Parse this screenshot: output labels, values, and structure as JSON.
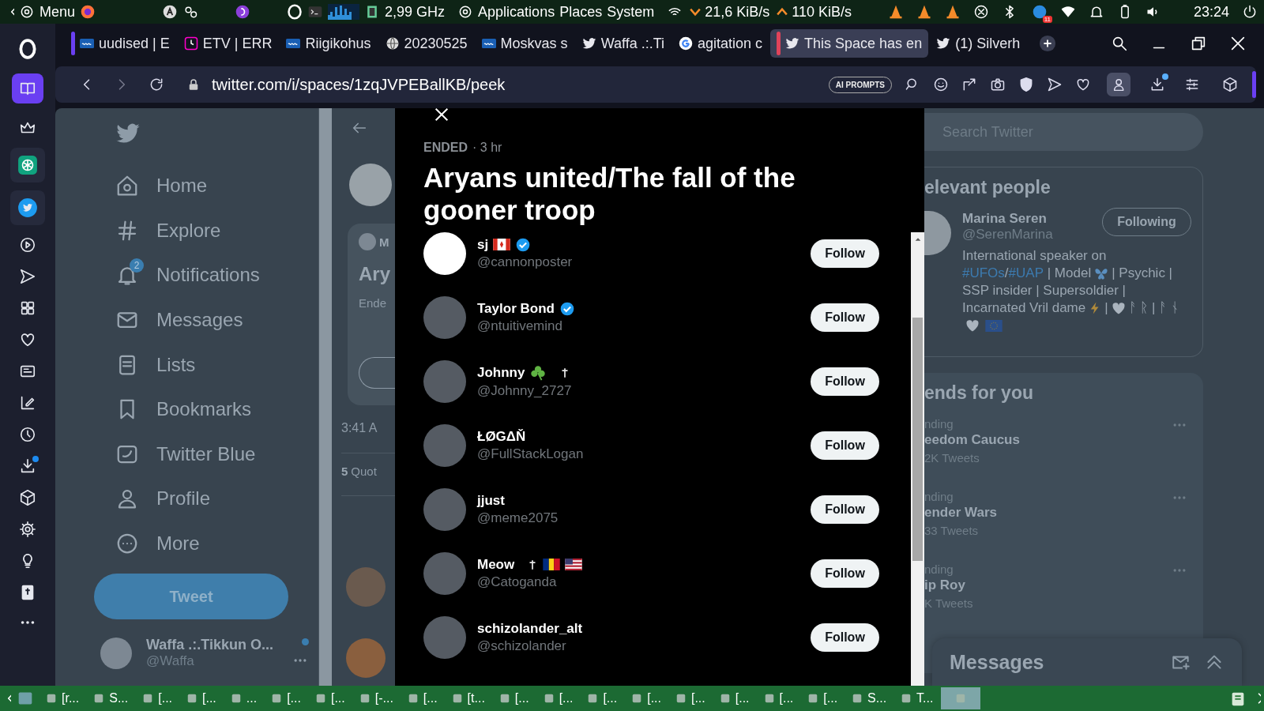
{
  "system_panel": {
    "menu": "Menu",
    "cpu": "2,99 GHz",
    "menus": [
      "Applications",
      "Places",
      "System"
    ],
    "down_speed": "21,6 KiB/s",
    "up_speed": "110 KiB/s",
    "tray_badge": "11",
    "clock": "23:24"
  },
  "opera_sidebar": [
    {
      "kind": "workspace",
      "selected": true
    },
    {
      "kind": "crown",
      "selected": false
    },
    {
      "kind": "chatgpt",
      "selected": false
    },
    {
      "kind": "twitter",
      "selected": false
    },
    {
      "kind": "player",
      "selected": false
    },
    {
      "kind": "send",
      "selected": false
    },
    {
      "kind": "grid",
      "selected": false
    },
    {
      "kind": "heart",
      "selected": false
    },
    {
      "kind": "news",
      "selected": false
    },
    {
      "kind": "pen",
      "selected": false
    },
    {
      "kind": "clock",
      "selected": false
    },
    {
      "kind": "download",
      "selected": false
    },
    {
      "kind": "cube",
      "selected": false
    },
    {
      "kind": "gear",
      "selected": false
    },
    {
      "kind": "bulb",
      "selected": false
    },
    {
      "kind": "book",
      "selected": false
    }
  ],
  "browser": {
    "tabs": [
      {
        "label": "uudised | E",
        "kind": "err",
        "selected": false,
        "color": "#6a3ff2"
      },
      {
        "label": "ETV | ERR",
        "kind": "etv",
        "selected": false
      },
      {
        "label": "Riigikohus",
        "kind": "err",
        "selected": false
      },
      {
        "label": "20230525",
        "kind": "globe",
        "selected": false
      },
      {
        "label": "Moskvas s",
        "kind": "err",
        "selected": false
      },
      {
        "label": "Waffa .:.Ti",
        "kind": "twitter",
        "selected": false
      },
      {
        "label": "agitation c",
        "kind": "google",
        "selected": false
      },
      {
        "label": "This Space has en",
        "kind": "twitter",
        "selected": true,
        "color": "#e0435a"
      },
      {
        "label": "(1) Silverh",
        "kind": "twitter",
        "selected": false
      }
    ],
    "address": "twitter.com/i/spaces/1zqJVPEBallKB/peek",
    "ai_button": "AI PROMPTS"
  },
  "twitter_nav": {
    "items": [
      {
        "label": "Home",
        "kind": "home"
      },
      {
        "label": "Explore",
        "kind": "hash"
      },
      {
        "label": "Notifications",
        "kind": "bell",
        "badge": "2"
      },
      {
        "label": "Messages",
        "kind": "mail"
      },
      {
        "label": "Lists",
        "kind": "list"
      },
      {
        "label": "Bookmarks",
        "kind": "bookmark"
      },
      {
        "label": "Twitter Blue",
        "kind": "blue"
      },
      {
        "label": "Profile",
        "kind": "person"
      },
      {
        "label": "More",
        "kind": "more"
      }
    ],
    "tweet_button": "Tweet",
    "account": {
      "name": "Waffa .:.Tikkun O...",
      "handle": "@Waffa"
    }
  },
  "background_column": {
    "card_author": "M",
    "card_title": "Ary",
    "card_status": "Ende",
    "time": "3:41 A",
    "quote_count": "5",
    "quote_label": "Quot"
  },
  "space_modal": {
    "status": "ENDED",
    "age": "· 3 hr",
    "title": "Aryans united/The fall of the gooner troop",
    "participants": [
      {
        "name": "sj",
        "handle": "@cannonposter",
        "badges": [
          {
            "kind": "flag_ca"
          },
          {
            "kind": "verified"
          }
        ],
        "button": "Follow"
      },
      {
        "name": "Taylor Bond",
        "handle": "@ntuitivemind",
        "badges": [
          {
            "kind": "verified"
          }
        ],
        "button": "Follow"
      },
      {
        "name": "Johnny",
        "handle": "@Johnny_2727",
        "badges": [
          {
            "kind": "shamrock"
          },
          {
            "kind": "cross"
          }
        ],
        "button": "Follow"
      },
      {
        "name": "ŁØGΔŇ",
        "handle": "@FullStackLogan",
        "button": "Follow"
      },
      {
        "name": "jjust",
        "handle": "@meme2075",
        "button": "Follow"
      },
      {
        "name": "Meow",
        "handle": "@Catoganda",
        "badges": [
          {
            "kind": "cross"
          },
          {
            "kind": "flag_ro"
          },
          {
            "kind": "flag_us"
          }
        ],
        "button": "Follow"
      },
      {
        "name": "schizolander_alt",
        "handle": "@schizolander",
        "button": "Follow"
      }
    ]
  },
  "right_column": {
    "search": {
      "placeholder": "Search Twitter"
    },
    "relevant": {
      "heading": "elevant people",
      "name": "Marina Seren",
      "handle": "@SerenMarina",
      "button": "Following",
      "bio": [
        [
          {
            "kind": "text",
            "text": "International speaker on"
          }
        ],
        [
          {
            "kind": "link",
            "text": "#UFOs"
          },
          {
            "kind": "text",
            "text": "/"
          },
          {
            "kind": "link",
            "text": "#UAP"
          },
          {
            "kind": "text",
            "text": " | Model"
          },
          {
            "kind": "butterfly"
          },
          {
            "kind": "text",
            "text": "| Psychic |"
          }
        ],
        [
          {
            "kind": "text",
            "text": "SSP insider | Supersoldier |"
          }
        ],
        [
          {
            "kind": "text",
            "text": "Incarnated Vril dame"
          },
          {
            "kind": "bolt"
          },
          {
            "kind": "text",
            "text": "|"
          },
          {
            "kind": "heart"
          },
          {
            "kind": "text",
            "text": "ᚨ ᚱ | ᚨ ᚾ"
          }
        ],
        [
          {
            "kind": "heart"
          },
          {
            "kind": "flag_eu"
          }
        ]
      ]
    },
    "trends": {
      "heading": "ends for you",
      "items": [
        {
          "context": "nding",
          "title": "eedom Caucus",
          "count": "2K Tweets"
        },
        {
          "context": "nding",
          "title": "ender Wars",
          "count": "33 Tweets"
        },
        {
          "context": "nding",
          "title": "ip Roy",
          "count": "K Tweets"
        }
      ]
    },
    "messages": "Messages"
  },
  "taskbar": {
    "items": [
      {
        "label": "[r...",
        "selected": false
      },
      {
        "label": "S...",
        "selected": false
      },
      {
        "label": "[...",
        "selected": false
      },
      {
        "label": "[...",
        "selected": false
      },
      {
        "label": "...",
        "selected": false
      },
      {
        "label": "[...",
        "selected": false
      },
      {
        "label": "[...",
        "selected": false
      },
      {
        "label": "[-...",
        "selected": false
      },
      {
        "label": "[...",
        "selected": false
      },
      {
        "label": "[t...",
        "selected": false
      },
      {
        "label": "[...",
        "selected": false
      },
      {
        "label": "[...",
        "selected": false
      },
      {
        "label": "[...",
        "selected": false
      },
      {
        "label": "[...",
        "selected": false
      },
      {
        "label": "[...",
        "selected": false
      },
      {
        "label": "[...",
        "selected": false
      },
      {
        "label": "[...",
        "selected": false
      },
      {
        "label": "[...",
        "selected": false
      },
      {
        "label": "S...",
        "selected": false
      },
      {
        "label": "T...",
        "selected": false
      },
      {
        "selected": true
      }
    ]
  }
}
